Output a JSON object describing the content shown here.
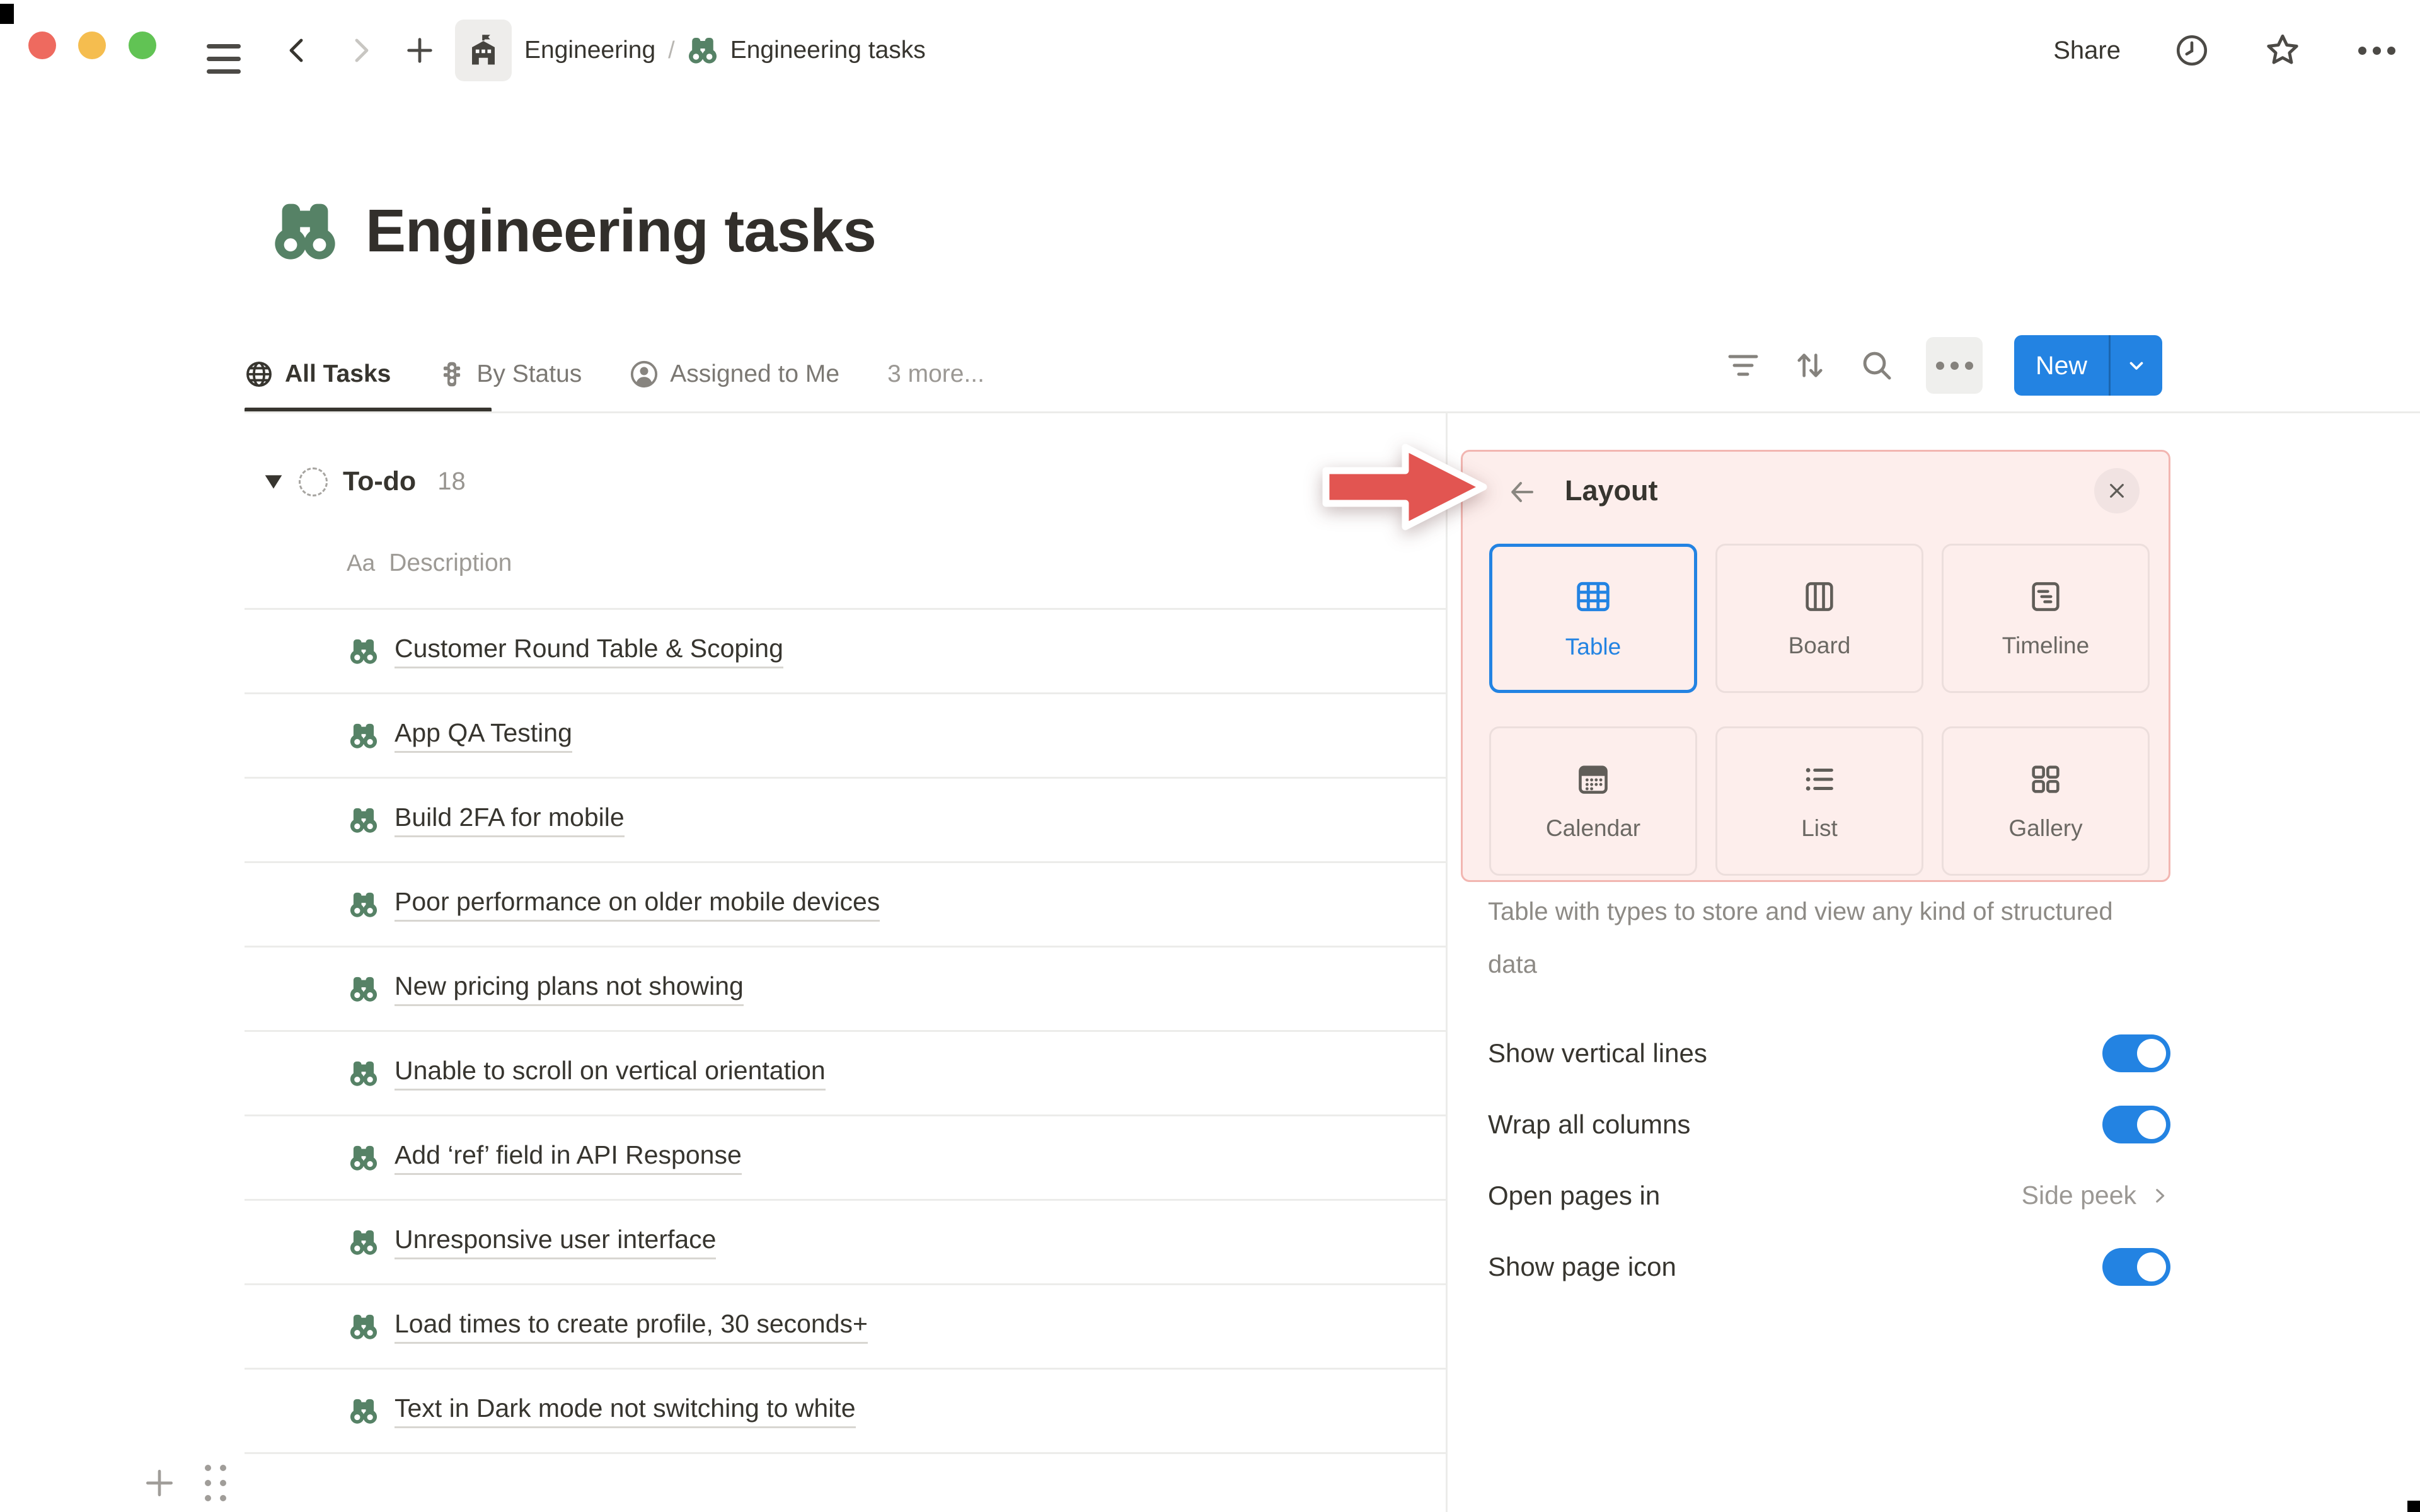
{
  "window": {
    "breadcrumb": {
      "workspace": "Engineering",
      "separator": "/",
      "page": "Engineering tasks"
    },
    "share_label": "Share"
  },
  "page": {
    "title": "Engineering tasks",
    "icon": "binoculars",
    "icon_color": "#568266"
  },
  "views": {
    "tabs": [
      {
        "label": "All Tasks",
        "icon": "globe-icon",
        "active": true
      },
      {
        "label": "By Status",
        "icon": "status-icon",
        "active": false
      },
      {
        "label": "Assigned to Me",
        "icon": "person-icon",
        "active": false
      },
      {
        "label": "3 more...",
        "icon": null,
        "active": false
      }
    ],
    "new_button_label": "New"
  },
  "table": {
    "group": {
      "name": "To-do",
      "count": "18"
    },
    "column_header": {
      "type_badge": "Aa",
      "label": "Description"
    },
    "rows": [
      {
        "title": "Customer Round Table & Scoping"
      },
      {
        "title": "App QA Testing"
      },
      {
        "title": "Build 2FA for mobile"
      },
      {
        "title": "Poor performance on older mobile devices"
      },
      {
        "title": "New pricing plans not showing"
      },
      {
        "title": "Unable to scroll on vertical orientation"
      },
      {
        "title": "Add ‘ref’ field in API Response"
      },
      {
        "title": "Unresponsive user interface"
      },
      {
        "title": "Load times to create profile, 30 seconds+"
      },
      {
        "title": "Text in Dark mode not switching to white"
      }
    ]
  },
  "layout_panel": {
    "title": "Layout",
    "options": [
      {
        "label": "Table",
        "icon": "table-icon",
        "selected": true
      },
      {
        "label": "Board",
        "icon": "board-icon",
        "selected": false
      },
      {
        "label": "Timeline",
        "icon": "timeline-icon",
        "selected": false
      },
      {
        "label": "Calendar",
        "icon": "calendar-icon",
        "selected": false
      },
      {
        "label": "List",
        "icon": "list-icon",
        "selected": false
      },
      {
        "label": "Gallery",
        "icon": "gallery-icon",
        "selected": false
      }
    ],
    "description": "Table with types to store and view any kind of structured data",
    "settings": [
      {
        "label": "Show vertical lines",
        "type": "toggle",
        "value": true
      },
      {
        "label": "Wrap all columns",
        "type": "toggle",
        "value": true
      },
      {
        "label": "Open pages in",
        "type": "link",
        "value": "Side peek"
      },
      {
        "label": "Show page icon",
        "type": "toggle",
        "value": true
      }
    ]
  },
  "colors": {
    "accent_blue": "#2383e2",
    "icon_green": "#568266",
    "highlight_red": "#e25551",
    "panel_pink_bg": "#fdeeec",
    "panel_pink_border": "#f2b6b1"
  }
}
